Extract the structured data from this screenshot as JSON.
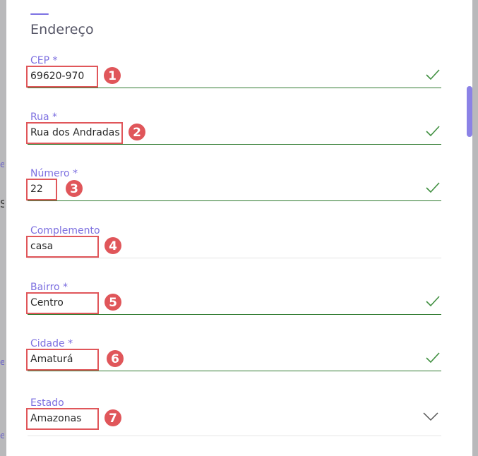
{
  "section": {
    "title": "Endereço"
  },
  "fields": [
    {
      "label": "CEP *",
      "value": "69620-970",
      "badge": "1",
      "valid": true
    },
    {
      "label": "Rua *",
      "value": "Rua dos Andradas",
      "badge": "2",
      "valid": true
    },
    {
      "label": "Número *",
      "value": "22",
      "badge": "3",
      "valid": true
    },
    {
      "label": "Complemento",
      "value": "casa",
      "badge": "4",
      "valid": false
    },
    {
      "label": "Bairro *",
      "value": "Centro",
      "badge": "5",
      "valid": true
    },
    {
      "label": "Cidade *",
      "value": "Amaturá",
      "badge": "6",
      "valid": true
    },
    {
      "label": "Estado",
      "value": "Amazonas",
      "badge": "7",
      "valid": false,
      "select": true
    }
  ],
  "background": {
    "fragment_letter": "S",
    "fragment_link": "e"
  },
  "colors": {
    "accent": "#7d70e0",
    "annotation": "#e0565a",
    "valid_line": "#2f7a2f",
    "valid_check": "#3f8f3f",
    "overlay": "#b9b9bb"
  },
  "icons": {
    "valid": "check-icon",
    "select": "chevron-down-icon"
  }
}
